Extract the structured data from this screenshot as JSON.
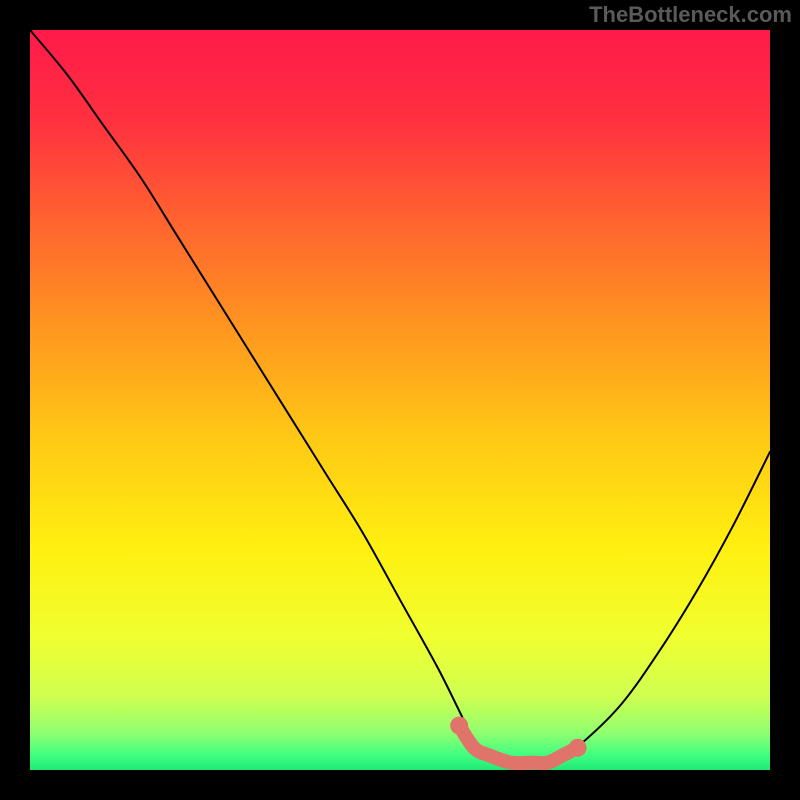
{
  "watermark": "TheBottleneck.com",
  "chart_data": {
    "type": "line",
    "title": "",
    "xlabel": "",
    "ylabel": "",
    "xlim": [
      0,
      100
    ],
    "ylim": [
      0,
      100
    ],
    "gradient_background": {
      "stops": [
        {
          "offset": 0.0,
          "color": "#ff1a4a"
        },
        {
          "offset": 0.12,
          "color": "#ff3040"
        },
        {
          "offset": 0.25,
          "color": "#ff6030"
        },
        {
          "offset": 0.4,
          "color": "#ff9520"
        },
        {
          "offset": 0.55,
          "color": "#ffc815"
        },
        {
          "offset": 0.7,
          "color": "#fff010"
        },
        {
          "offset": 0.82,
          "color": "#f0ff30"
        },
        {
          "offset": 0.9,
          "color": "#d0ff50"
        },
        {
          "offset": 0.95,
          "color": "#90ff70"
        },
        {
          "offset": 0.98,
          "color": "#40ff80"
        },
        {
          "offset": 1.0,
          "color": "#20e878"
        }
      ]
    },
    "series": [
      {
        "name": "bottleneck-curve",
        "x": [
          0,
          5,
          10,
          15,
          20,
          25,
          30,
          35,
          40,
          45,
          50,
          55,
          58,
          60,
          62,
          65,
          68,
          70,
          72,
          75,
          80,
          85,
          90,
          95,
          100
        ],
        "values": [
          100,
          94,
          87,
          80,
          72,
          64,
          56,
          48,
          40,
          32,
          23,
          14,
          8,
          4,
          2,
          1,
          1,
          1,
          2,
          4,
          9,
          16,
          24,
          33,
          43
        ],
        "color": "#000000",
        "width": 2
      }
    ],
    "highlight_segment": {
      "x": [
        58,
        60,
        62,
        65,
        68,
        70,
        72,
        74
      ],
      "values": [
        6,
        3,
        2,
        1,
        1,
        1,
        2,
        3
      ],
      "color": "#e0736a",
      "width": 14,
      "end_markers": [
        {
          "x": 58,
          "y": 6
        },
        {
          "x": 74,
          "y": 3
        }
      ]
    }
  }
}
